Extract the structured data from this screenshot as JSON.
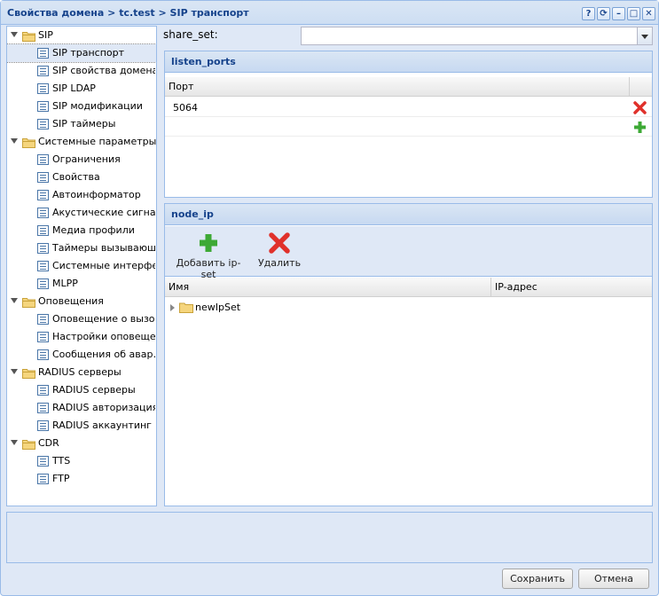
{
  "window": {
    "title": "Свойства домена > tc.test > SIP транспорт",
    "tools": [
      "?",
      "⟳",
      "–",
      "□",
      "✕"
    ]
  },
  "tree": {
    "groups": [
      {
        "label": "SIP",
        "items": [
          "SIP транспорт",
          "SIP свойства домена",
          "SIP LDAP",
          "SIP модификации",
          "SIP таймеры"
        ]
      },
      {
        "label": "Системные параметры",
        "items": [
          "Ограничения",
          "Свойства",
          "Автоинформатор",
          "Акустические сигна…",
          "Медиа профили",
          "Таймеры вызывающ…",
          "Системные интерфе…",
          "MLPP"
        ]
      },
      {
        "label": "Оповещения",
        "items": [
          "Оповещение о вызо…",
          "Настройки оповеще…",
          "Сообщения об авар…"
        ]
      },
      {
        "label": "RADIUS серверы",
        "items": [
          "RADIUS серверы",
          "RADIUS авторизация",
          "RADIUS аккаунтинг"
        ]
      },
      {
        "label": "CDR",
        "items": [
          "TTS",
          "FTP"
        ]
      }
    ],
    "selected": "SIP транспорт"
  },
  "share_set": {
    "label": "share_set:",
    "value": ""
  },
  "listen_ports": {
    "title": "listen_ports",
    "column": "Порт",
    "rows": [
      "5064"
    ]
  },
  "node_ip": {
    "title": "node_ip",
    "add_label": "Добавить ip-set",
    "delete_label": "Удалить",
    "columns": [
      "Имя",
      "IP-адрес"
    ],
    "rows": [
      "newIpSet"
    ]
  },
  "buttons": {
    "save": "Сохранить",
    "cancel": "Отмена"
  },
  "colors": {
    "title_text": "#15428b",
    "border": "#99bbe8",
    "panel_bg": "#dfe8f6",
    "delete_red": "#e0312b",
    "add_green": "#3da935"
  }
}
